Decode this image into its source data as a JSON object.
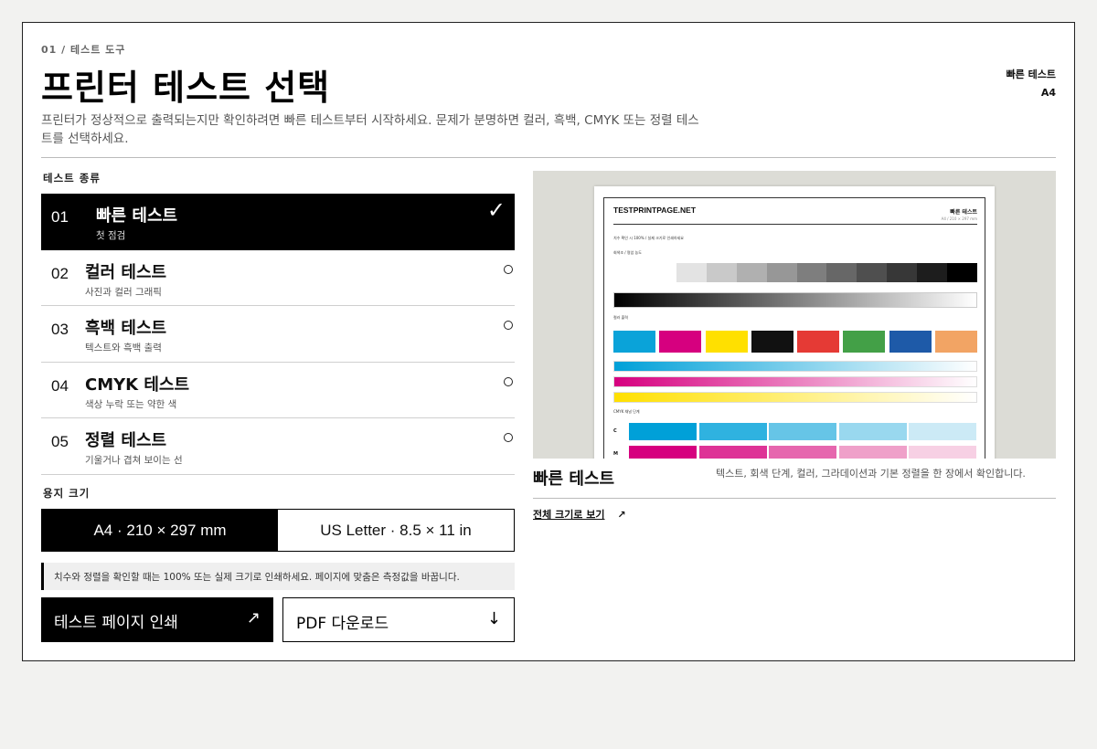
{
  "header": {
    "eyebrow": "01 / 테스트 도구",
    "title": "프린터 테스트 선택",
    "lede": "프린터가 정상적으로 출력되는지만 확인하려면 빠른 테스트부터 시작하세요. 문제가 분명하면 컬러, 흑백, CMYK 또는 정렬 테스트를 선택하세요.",
    "meta_test": "빠른 테스트",
    "meta_size": "A4"
  },
  "tests_label": "테스트 종류",
  "tests": [
    {
      "num": "01",
      "name": "빠른 테스트",
      "sub": "첫 점검",
      "selected": true
    },
    {
      "num": "02",
      "name": "컬러 테스트",
      "sub": "사진과 컬러 그래픽",
      "selected": false
    },
    {
      "num": "03",
      "name": "흑백 테스트",
      "sub": "텍스트와 흑백 출력",
      "selected": false
    },
    {
      "num": "04",
      "name": "CMYK 테스트",
      "sub": "색상 누락 또는 약한 색",
      "selected": false
    },
    {
      "num": "05",
      "name": "정렬 테스트",
      "sub": "기울거나 겹쳐 보이는 선",
      "selected": false
    }
  ],
  "check_glyph": "✓",
  "paper_label": "용지 크기",
  "paper": {
    "a4": "A4 · 210 × 297 mm",
    "letter": "US Letter · 8.5 × 11 in",
    "selected": "a4"
  },
  "note": "치수와 정렬을 확인할 때는 100% 또는 실제 크기로 인쇄하세요. 페이지에 맞춤은 측정값을 바꿉니다.",
  "actions": {
    "print_label": "테스트 페이지 인쇄",
    "print_icon": "↗",
    "pdf_label": "PDF 다운로드",
    "pdf_icon": "↓"
  },
  "preview": {
    "sheet": {
      "brand": "TESTPRINTPAGE.NET",
      "title": "빠른 테스트",
      "size": "A4 / 210 × 297 mm",
      "instruction": "치수 확인 시 100% / 실제 크기로 인쇄하세요",
      "gray_label": "회색조 / 명암 농도",
      "color_label": "컬러 출력",
      "cmyk_label": "CMYK 채널 단계",
      "c_label": "C",
      "m_label": "M"
    },
    "gray_steps": [
      "#ffffff",
      "#e3e3e3",
      "#c9c9c9",
      "#b0b0b0",
      "#979797",
      "#7e7e7e",
      "#676767",
      "#4f4f4f",
      "#373737",
      "#1d1d1d",
      "#000000"
    ],
    "swatches": [
      "#0aa3d9",
      "#d6007f",
      "#ffe000",
      "#111111",
      "#e53a35",
      "#43a047",
      "#1e5aa8",
      "#f2a464"
    ],
    "c_steps": [
      "#00a0d8",
      "#2fb2e0",
      "#66c5e7",
      "#99d8ef",
      "#cceaf6"
    ],
    "m_steps": [
      "#d6007f",
      "#de3396",
      "#e666ae",
      "#efa0c9",
      "#f7d0e4"
    ],
    "title": "빠른 테스트",
    "description": "텍스트, 회색 단계, 컬러, 그라데이션과 기본 정렬을 한 장에서 확인합니다.",
    "link_label": "전체 크기로 보기",
    "link_icon": "↗"
  }
}
